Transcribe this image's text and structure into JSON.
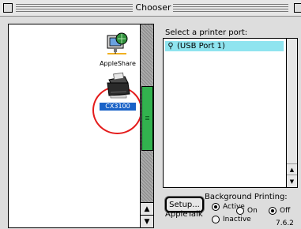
{
  "window": {
    "title": "Chooser"
  },
  "devices": [
    {
      "label": "AppleShare",
      "icon": "appleshare-icon",
      "selected": false
    },
    {
      "label": "CX3100",
      "icon": "printer-icon",
      "selected": true
    }
  ],
  "port": {
    "label": "Select a printer port:",
    "items": [
      {
        "label": "(USB Port 1)",
        "icon": "usb-icon",
        "selected": true
      }
    ]
  },
  "setup": {
    "label": "Setup..."
  },
  "background_printing": {
    "label": "Background Printing:",
    "on_label": "On",
    "off_label": "Off",
    "value": "Off"
  },
  "appletalk": {
    "label": "AppleTalk",
    "active_label": "Active",
    "inactive_label": "Inactive",
    "value": "Active"
  },
  "version": "7.6.2",
  "colors": {
    "selection_cyan": "#8fe4ef",
    "scroll_thumb_green": "#32b24e",
    "highlight_blue": "#1a63c8",
    "annotation_red": "#e41b1b"
  }
}
